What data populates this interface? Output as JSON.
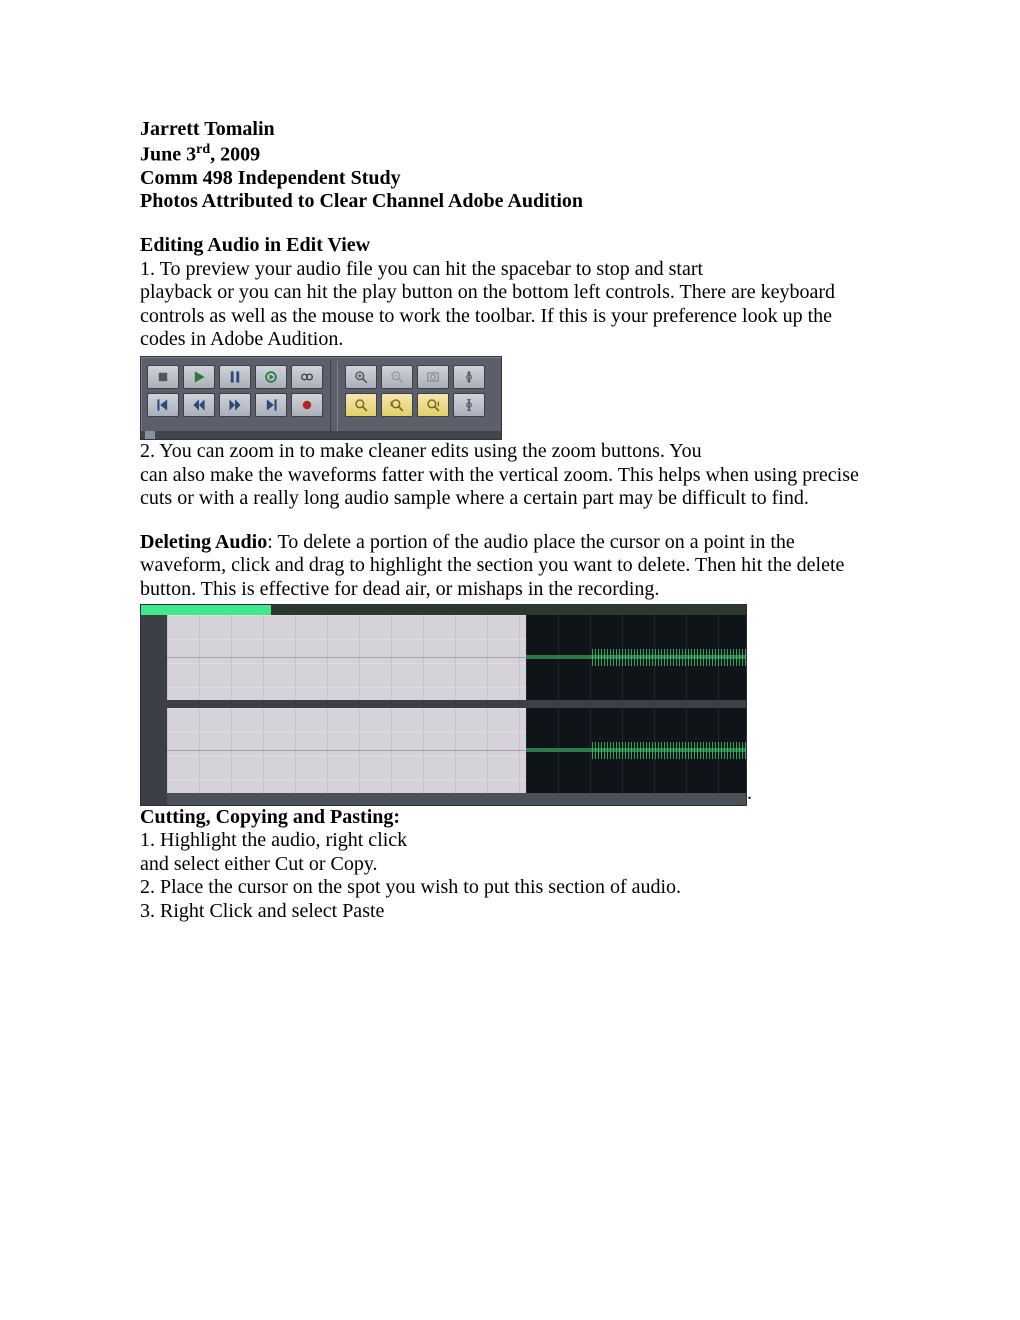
{
  "header": {
    "author": "Jarrett Tomalin",
    "date_prefix": "June 3",
    "date_suffix": "rd",
    "date_year": ", 2009",
    "course": "Comm 498 Independent Study",
    "attribution": "Photos Attributed to Clear Channel Adobe Audition"
  },
  "section1": {
    "title": "Editing Audio in Edit View",
    "item1_num": "1. ",
    "item1_line1": "To preview your audio file you can hit the spacebar to stop and start",
    "item1_line2": "playback or you can hit the play button on the bottom left controls. There are keyboard controls as well as the mouse to work the toolbar. If this is your preference look up the codes in Adobe Audition."
  },
  "toolbar": {
    "transport": {
      "row1": [
        "stop-icon",
        "play-icon",
        "pause-icon",
        "play-loop-icon",
        "loop-icon"
      ],
      "row2": [
        "go-start-icon",
        "rewind-icon",
        "fast-forward-icon",
        "go-end-icon",
        "record-icon"
      ]
    },
    "zoom": {
      "row1": [
        "zoom-in-icon",
        "zoom-out-icon",
        "zoom-full-icon",
        "zoom-vert-in-icon"
      ],
      "row2": [
        "zoom-sel-icon",
        "zoom-left-icon",
        "zoom-right-icon",
        "zoom-vert-out-icon"
      ]
    }
  },
  "section2": {
    "item2_num": "2. ",
    "item2_line1": "You can zoom in to make cleaner edits using the zoom buttons. You",
    "item2_line2": "can also make the waveforms fatter with the vertical zoom. This helps when using precise cuts or with a really long audio sample where a certain part may be difficult to find."
  },
  "deleting": {
    "label": "Deleting Audio",
    "text": ": To delete a portion of the audio place the cursor on a point in the waveform, click and drag to highlight the section you want to delete. Then hit the delete button. This is effective for dead air, or mishaps in the recording."
  },
  "ccp": {
    "title": "Cutting, Copying and Pasting:",
    "i1a": "1. Highlight the audio, right click",
    "i1b": "and select either Cut or Copy.",
    "i2": "2. Place the cursor on the spot you wish to put this section of audio.",
    "i3": "3. Right Click and select Paste"
  }
}
